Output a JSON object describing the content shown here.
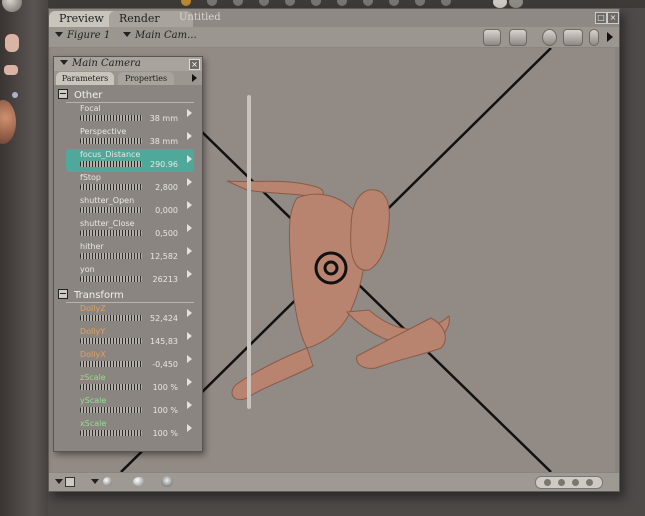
{
  "window": {
    "tabs": [
      {
        "label": "Preview"
      },
      {
        "label": "Render"
      }
    ],
    "document_title": "Untitled",
    "close_glyph": "×"
  },
  "toolbar": {
    "figure_menu": "Figure 1",
    "camera_menu": "Main Cam..."
  },
  "panel": {
    "title": "Main Camera",
    "close_glyph": "×",
    "tabs": [
      {
        "label": "Parameters"
      },
      {
        "label": "Properties"
      }
    ],
    "groups": [
      {
        "label": "Other",
        "params": [
          {
            "name": "Focal",
            "value": "38 mm"
          },
          {
            "name": "Perspective",
            "value": "38 mm"
          },
          {
            "name": "focus_Distance",
            "value": "290.96"
          },
          {
            "name": "fStop",
            "value": "2,800"
          },
          {
            "name": "shutter_Open",
            "value": "0,000"
          },
          {
            "name": "shutter_Close",
            "value": "0,500"
          },
          {
            "name": "hither",
            "value": "12,582"
          },
          {
            "name": "yon",
            "value": "26213"
          }
        ]
      },
      {
        "label": "Transform",
        "params": [
          {
            "name": "DollyZ",
            "value": "52,424"
          },
          {
            "name": "DollyY",
            "value": "145,83"
          },
          {
            "name": "DollyX",
            "value": "-0,450"
          },
          {
            "name": "zScale",
            "value": "100 %"
          },
          {
            "name": "yScale",
            "value": "100 %"
          },
          {
            "name": "xScale",
            "value": "100 %"
          }
        ]
      }
    ]
  },
  "colors": {
    "selected_param": "#4fa89a",
    "dolly_label": "#e0a060",
    "scale_label": "#8fe08a",
    "figure_skin": "#b9846f",
    "crosshair": "#101010"
  },
  "icons": [
    "camera-icon",
    "camera2-icon",
    "sphere-icon",
    "move-icon",
    "pill-icon",
    "play-icon",
    "lighting-icon",
    "figure-icon"
  ]
}
